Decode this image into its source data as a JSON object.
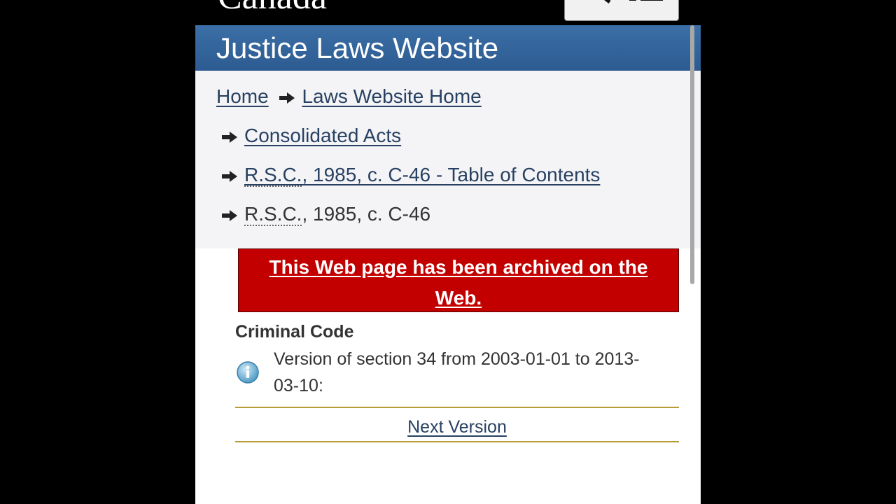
{
  "header": {
    "wordmark": "Canada",
    "site_title": "Justice Laws Website"
  },
  "breadcrumb": {
    "home": "Home",
    "laws_home": "Laws Website Home",
    "consolidated_acts": "Consolidated Acts",
    "toc_abbr": "R.S.C.",
    "toc_rest": ", 1985, c. C-46 -  Table of Contents",
    "current_abbr": "R.S.C.",
    "current_rest": ", 1985, c. C-46"
  },
  "archive": {
    "line1": "This Web page has been archived on the",
    "line2": "Web."
  },
  "act": {
    "title": "Criminal Code",
    "version_line1": "Version of section 34 from 2003-01-01 to 2013-",
    "version_line2": "03-10:",
    "next_version": "Next Version"
  },
  "icons": [
    "search-icon",
    "menu-icon",
    "arrow-right-icon",
    "info-icon"
  ],
  "colors": {
    "title_bar": "#2c5b91",
    "link": "#284162",
    "archive_bg": "#c30000",
    "rule": "#b89a36",
    "breadcrumb_bg": "#f4f4f7"
  }
}
